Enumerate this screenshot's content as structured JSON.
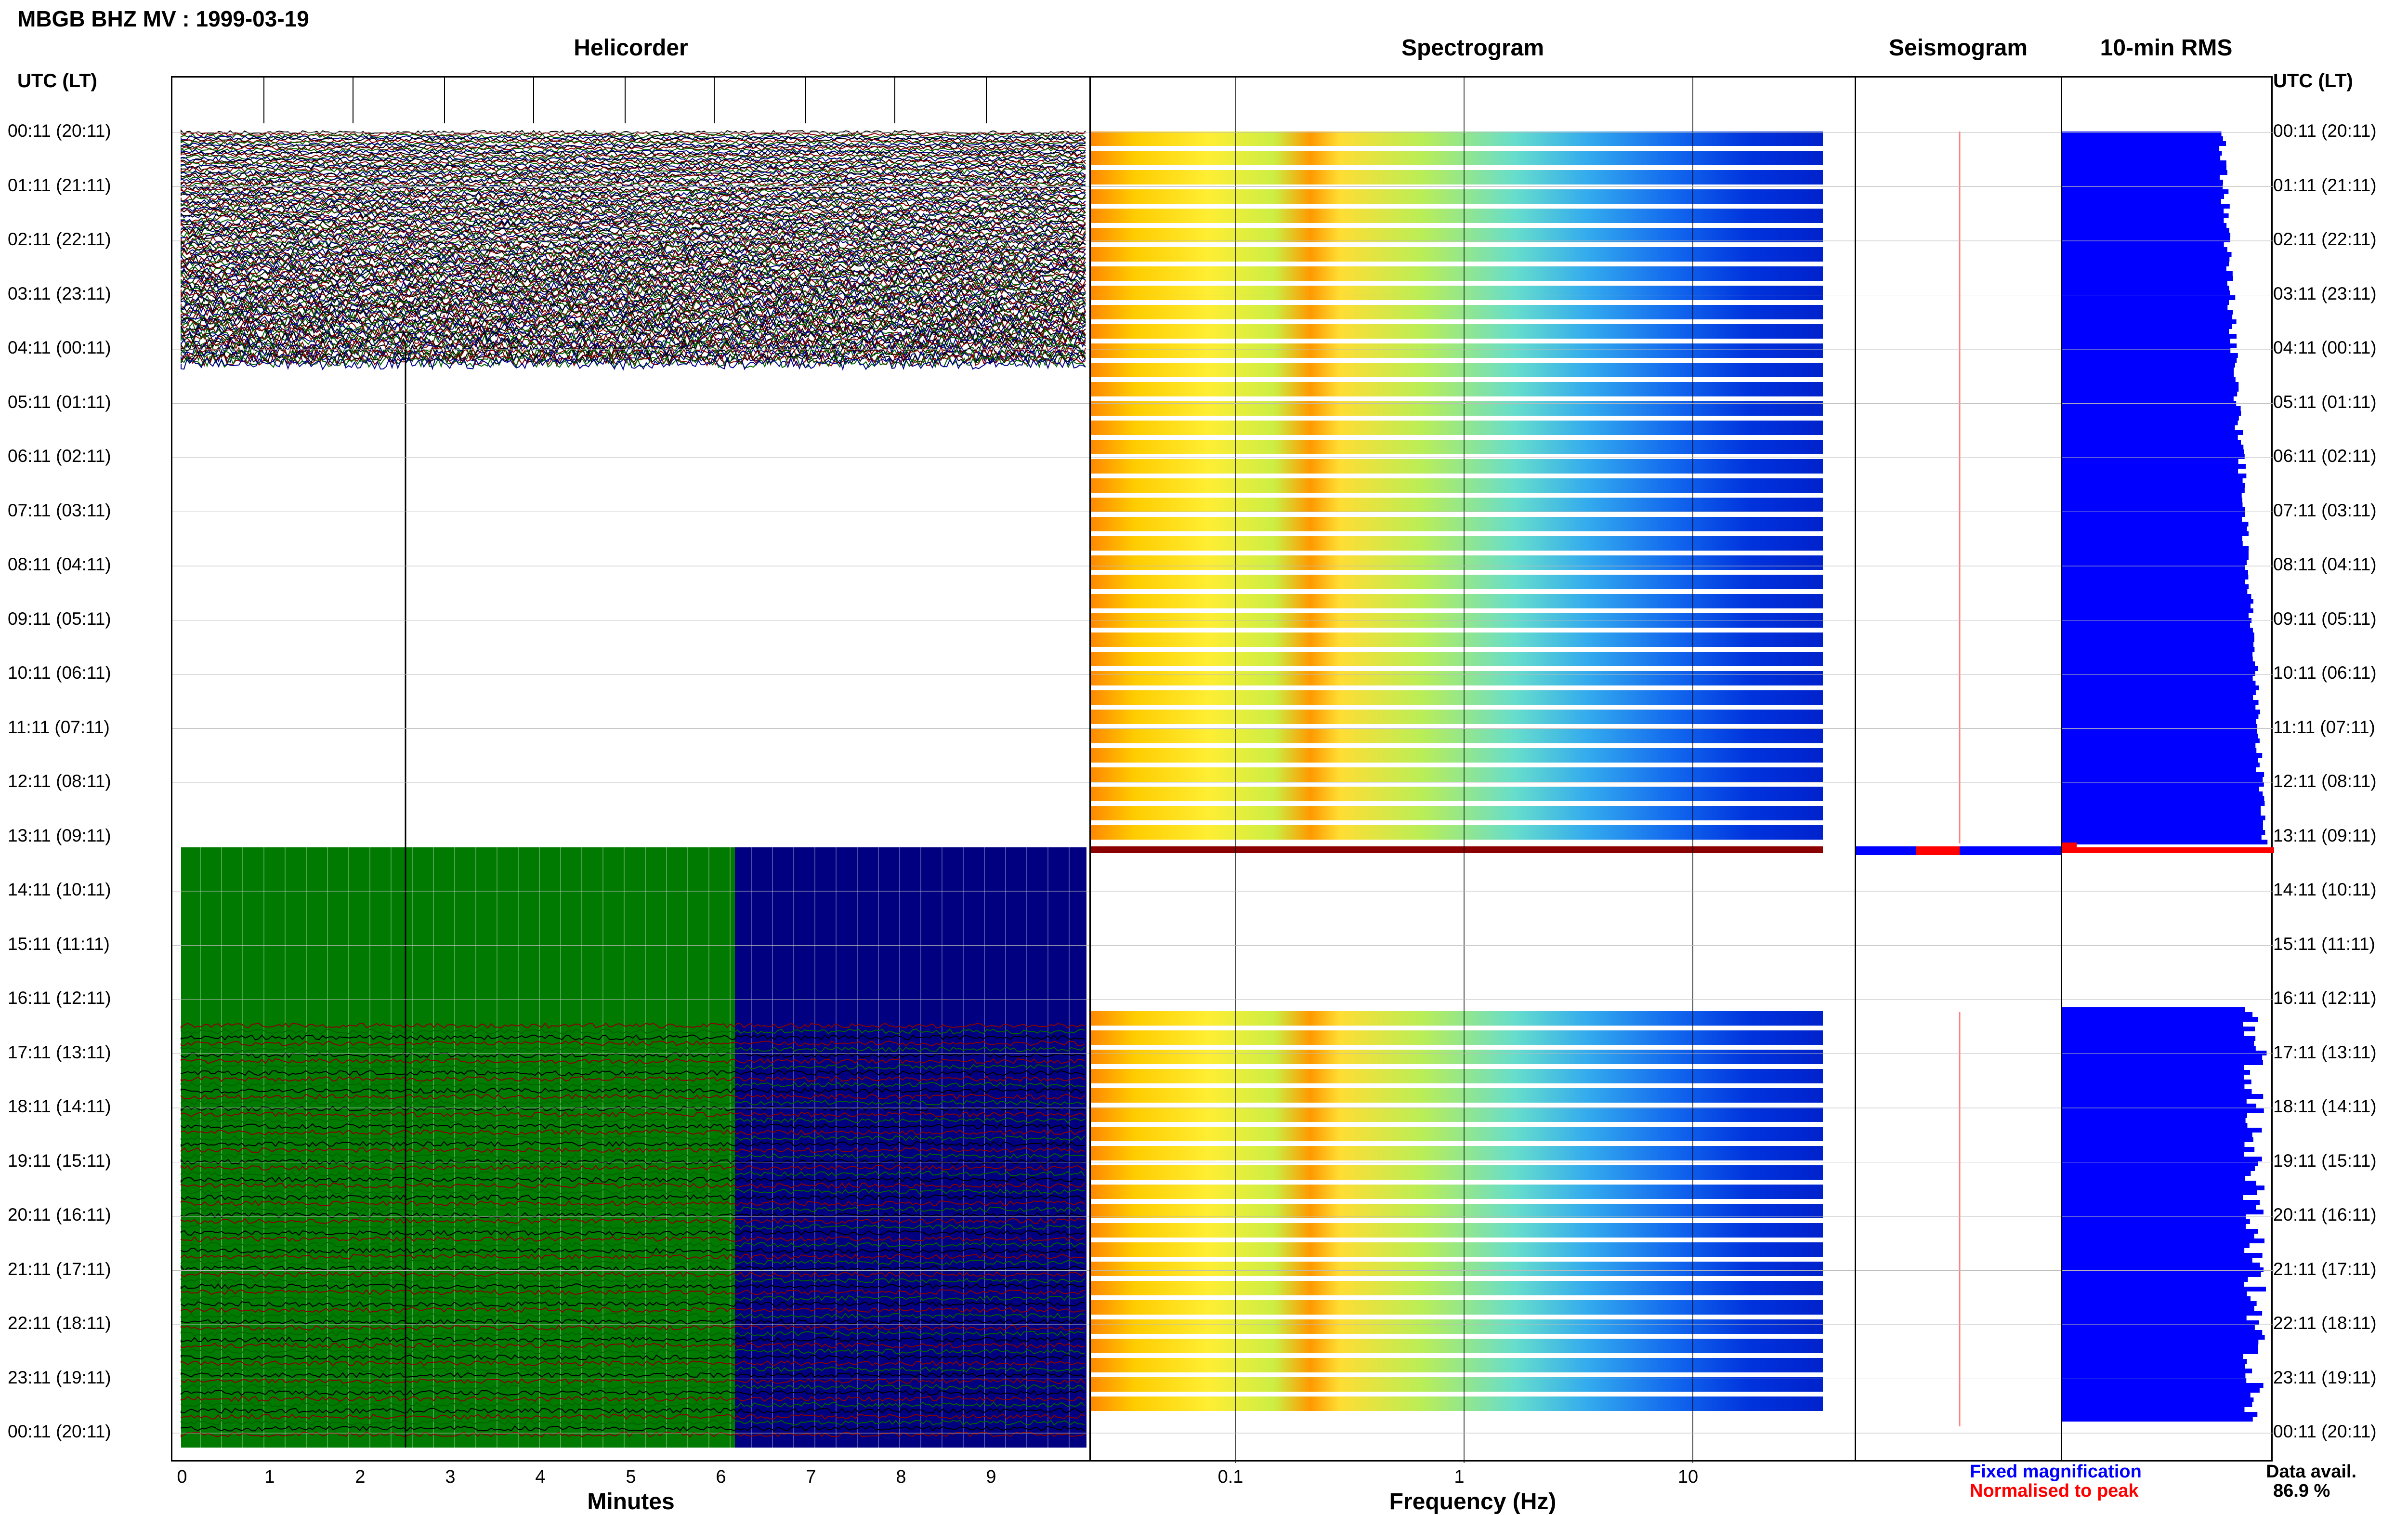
{
  "header": {
    "station": "MBGB BHZ MV : 1999-03-19"
  },
  "panels": {
    "helicorder": "Helicorder",
    "spectrogram": "Spectrogram",
    "seismogram": "Seismogram",
    "rms": "10-min RMS"
  },
  "time_axis": {
    "header": "UTC (LT)",
    "labels": [
      "00:11 (20:11)",
      "01:11 (21:11)",
      "02:11 (22:11)",
      "03:11 (23:11)",
      "04:11 (00:11)",
      "05:11 (01:11)",
      "06:11 (02:11)",
      "07:11 (03:11)",
      "08:11 (04:11)",
      "09:11 (05:11)",
      "10:11 (06:11)",
      "11:11 (07:11)",
      "12:11 (08:11)",
      "13:11 (09:11)",
      "14:11 (10:11)",
      "15:11 (11:11)",
      "16:11 (12:11)",
      "17:11 (13:11)",
      "18:11 (14:11)",
      "19:11 (15:11)",
      "20:11 (16:11)",
      "21:11 (17:11)",
      "22:11 (18:11)",
      "23:11 (19:11)",
      "00:11 (20:11)"
    ]
  },
  "helicorder_axis": {
    "ticks": [
      "0",
      "1",
      "2",
      "3",
      "4",
      "5",
      "6",
      "7",
      "8",
      "9"
    ],
    "title": "Minutes"
  },
  "frequency_axis": {
    "ticks": [
      "0.1",
      "1",
      "10"
    ],
    "title": "Frequency (Hz)"
  },
  "legend": {
    "fixed": "Fixed magnification",
    "normalised": "Normalised to peak",
    "fixed_color": "#0000ff",
    "normalised_color": "#ff0000"
  },
  "availability": {
    "label": "Data avail.",
    "value": "86.9 %"
  },
  "colors": {
    "trace": [
      "#000000",
      "#8b0000",
      "#006400",
      "#00008b"
    ],
    "rms_bar": "#0000ff",
    "saturated_green": "#007a00",
    "saturated_blue": "#000080"
  }
}
